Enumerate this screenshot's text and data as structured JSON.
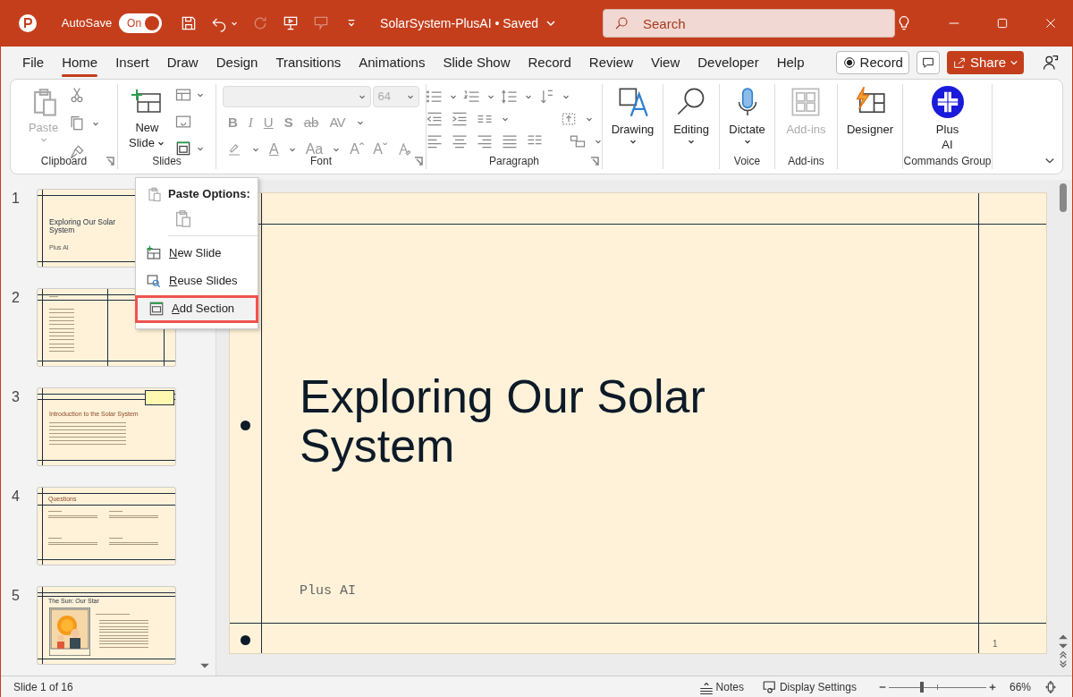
{
  "title_bar": {
    "autosave_label": "AutoSave",
    "autosave_toggle": {
      "label": "On",
      "on": true
    },
    "document_title": "SolarSystem-PlusAI • Saved",
    "search": {
      "placeholder": "Search"
    }
  },
  "menu_tabs": [
    {
      "label": "File",
      "selected": false
    },
    {
      "label": "Home",
      "selected": true
    },
    {
      "label": "Insert",
      "selected": false
    },
    {
      "label": "Draw",
      "selected": false
    },
    {
      "label": "Design",
      "selected": false
    },
    {
      "label": "Transitions",
      "selected": false
    },
    {
      "label": "Animations",
      "selected": false
    },
    {
      "label": "Slide Show",
      "selected": false
    },
    {
      "label": "Record",
      "selected": false
    },
    {
      "label": "Review",
      "selected": false
    },
    {
      "label": "View",
      "selected": false
    },
    {
      "label": "Developer",
      "selected": false
    },
    {
      "label": "Help",
      "selected": false
    }
  ],
  "menu_buttons": {
    "record": "Record",
    "share": "Share"
  },
  "ribbon_groups": [
    {
      "kind": "clipboard",
      "label": "Clipboard",
      "buttons": [
        {
          "lines": [
            "Paste"
          ],
          "disabled": true
        }
      ]
    },
    {
      "kind": "slides",
      "label": "Slides",
      "buttons": [
        {
          "lines": [
            "New",
            "Slide"
          ],
          "disabled": false
        }
      ]
    },
    {
      "kind": "font",
      "label": "Font",
      "font_size": "64",
      "format_buttons": [
        "B",
        "I",
        "U",
        "S",
        "ab",
        "AV"
      ],
      "size_buttons": [
        "A",
        "Aa",
        "Aˆ",
        "Aˇ"
      ]
    },
    {
      "kind": "paragraph",
      "label": "Paragraph"
    },
    {
      "kind": "drawing",
      "buttons": [
        {
          "lines": [
            "Drawing"
          ],
          "disabled": false
        }
      ]
    },
    {
      "kind": "editing",
      "buttons": [
        {
          "lines": [
            "Editing"
          ],
          "disabled": false
        }
      ]
    },
    {
      "kind": "voice",
      "label": "Voice",
      "buttons": [
        {
          "lines": [
            "Dictate"
          ],
          "disabled": false
        }
      ]
    },
    {
      "kind": "addins",
      "label": "Add-ins",
      "buttons": [
        {
          "lines": [
            "Add-ins"
          ],
          "disabled": true
        }
      ]
    },
    {
      "kind": "designer",
      "buttons": [
        {
          "lines": [
            "Designer"
          ],
          "disabled": false
        }
      ]
    },
    {
      "kind": "commands",
      "label": "Commands Group",
      "buttons": [
        {
          "lines": [
            "Plus",
            "AI"
          ],
          "disabled": false
        }
      ]
    }
  ],
  "slide_thumbnails": [
    {
      "number": "1",
      "kind": "title",
      "title": "Exploring Our Solar System",
      "subtitle": "Plus AI"
    },
    {
      "number": "2",
      "kind": "agenda"
    },
    {
      "number": "3",
      "kind": "text",
      "title": "Introduction to the Solar System"
    },
    {
      "number": "4",
      "kind": "questions",
      "title": "Questions"
    },
    {
      "number": "5",
      "title": "The Sun: Our Star"
    }
  ],
  "context_menu": {
    "header": "Paste Options:",
    "items": [
      {
        "label": "New Slide",
        "kind": "new",
        "selected": false
      },
      {
        "label": "Reuse Slides",
        "kind": "reuse",
        "selected": false
      },
      {
        "label": "Add Section",
        "kind": "section",
        "selected": true
      }
    ]
  },
  "slide": {
    "title": "Exploring Our Solar System",
    "subtitle": "Plus AI",
    "page_number": "1"
  },
  "status_bar": {
    "slide_info": "Slide 1 of 16",
    "notes": "Notes",
    "display_settings": "Display Settings",
    "zoom": {
      "level": 0.33
    },
    "zoom_text": "66%"
  }
}
